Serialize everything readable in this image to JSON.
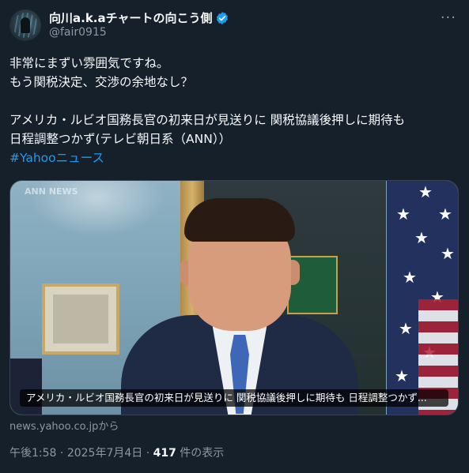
{
  "post": {
    "author": {
      "display_name": "向川a.k.aチャートの向こう側",
      "handle": "@fair0915"
    },
    "more_label": "···",
    "text_lines": [
      "非常にまずい雰囲気ですね。",
      "もう関税決定、交渉の余地なし？",
      "",
      "アメリカ・ルビオ国務長官の初来日が見送りに 関税協議後押しに期待も",
      "日程調整つかず(テレビ朝日系（ANN））"
    ],
    "hashtag": "#Yahooニュース",
    "card": {
      "watermark": "ANN NEWS",
      "caption": "アメリカ・ルビオ国務長官の初来日が見送りに 関税協議後押しに期待も 日程調整つかず..."
    },
    "source": "news.yahoo.co.jpから",
    "meta": {
      "time": "午後1:58",
      "separator": " · ",
      "date": "2025年7月4日",
      "views_count": "417",
      "views_label": " 件の表示"
    }
  },
  "colors": {
    "background": "#15202b",
    "text_primary": "#f7f9f9",
    "text_secondary": "#8b98a5",
    "link": "#1d9bf0",
    "verified_badge": "#1d9bf0"
  }
}
